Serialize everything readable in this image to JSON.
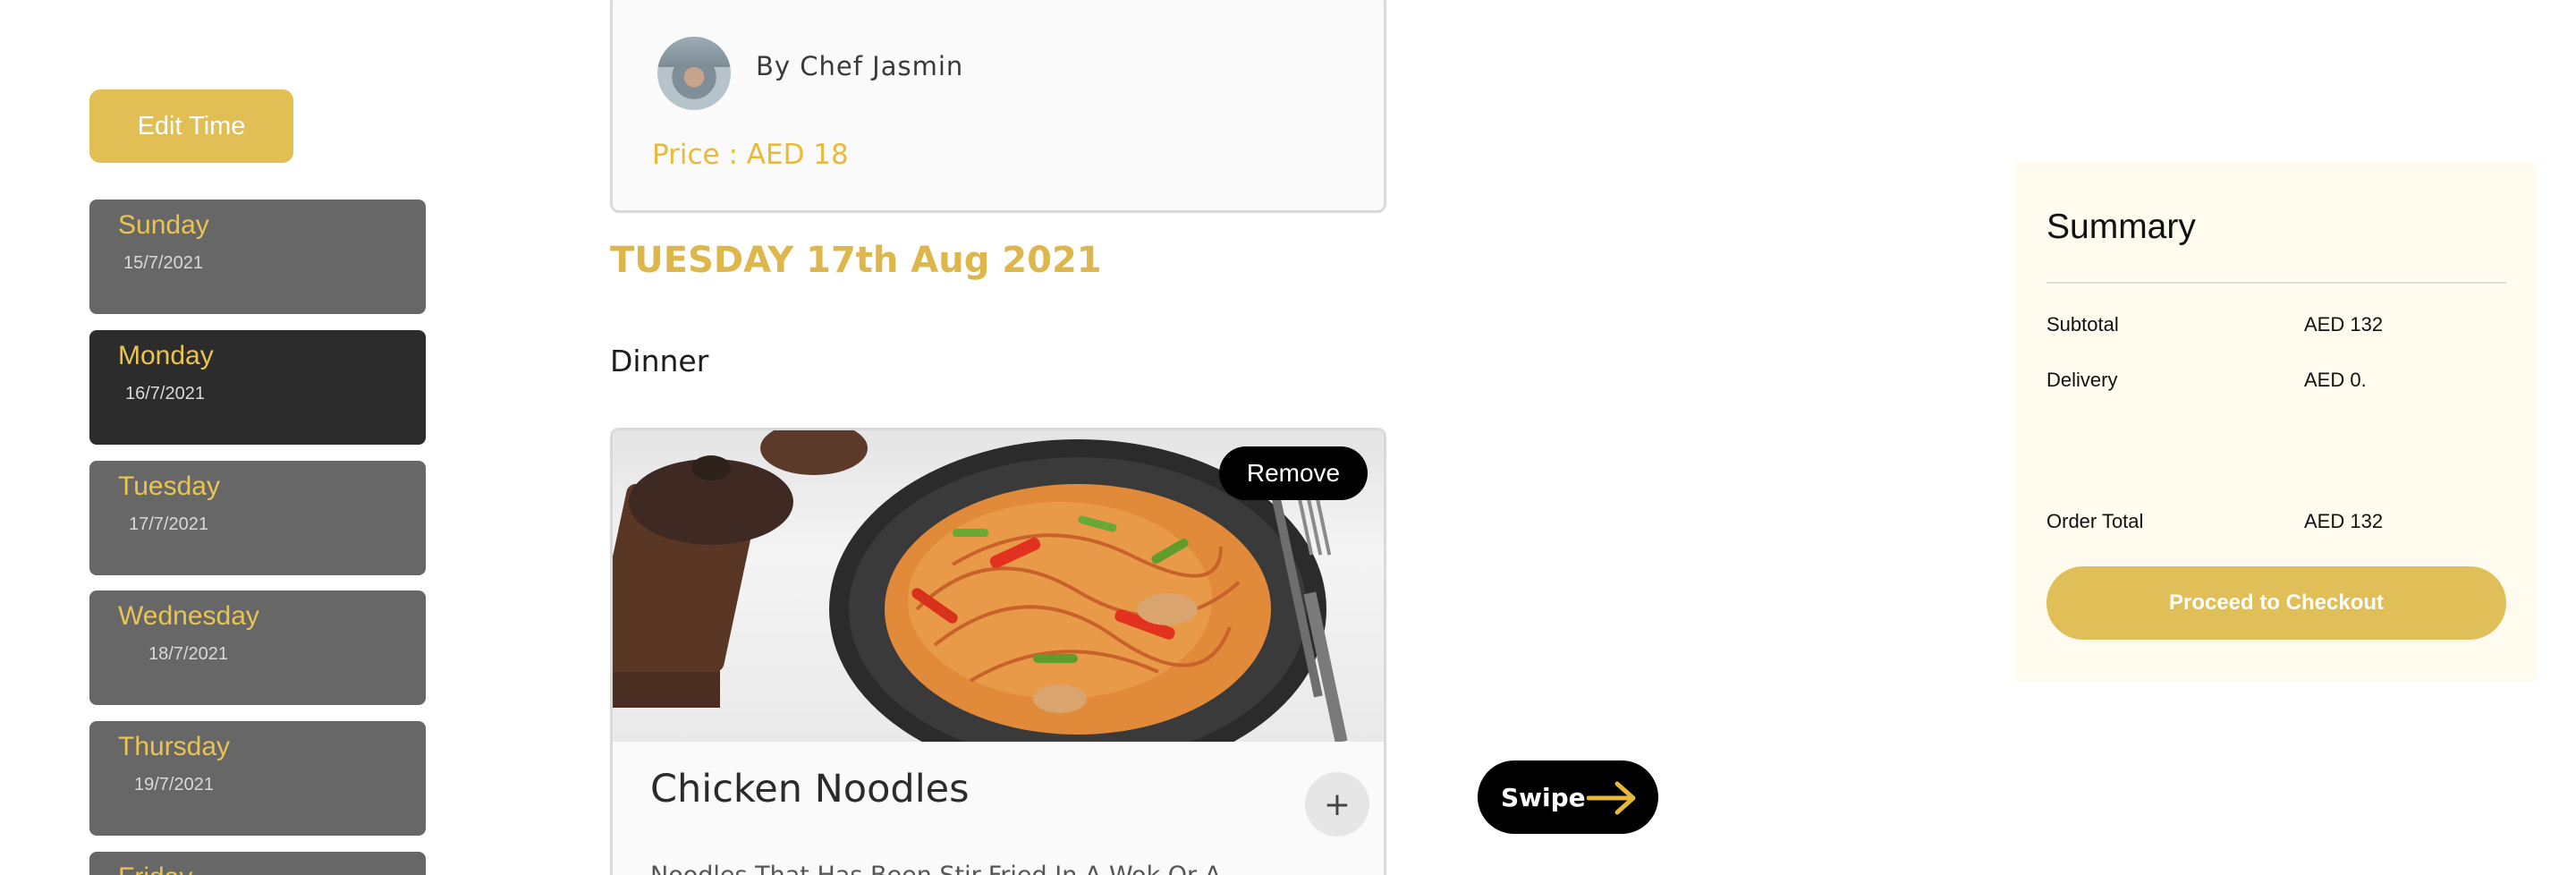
{
  "sidebar": {
    "edit_time_label": "Edit Time",
    "days": [
      {
        "name": "Sunday",
        "date": "15/7/2021",
        "active": false
      },
      {
        "name": "Monday",
        "date": "16/7/2021",
        "active": true
      },
      {
        "name": "Tuesday",
        "date": "17/7/2021",
        "active": false
      },
      {
        "name": "Wednesday",
        "date": "18/7/2021",
        "active": false
      },
      {
        "name": "Thursday",
        "date": "19/7/2021",
        "active": false
      },
      {
        "name": "Friday",
        "date": "",
        "active": false
      }
    ]
  },
  "chef_card": {
    "chef_name": "By Chef Jasmin",
    "price": "Price : AED 18"
  },
  "main": {
    "date_heading": "TUESDAY 17th Aug 2021",
    "meal_label": "Dinner"
  },
  "food_card": {
    "remove_label": "Remove",
    "title": "Chicken Noodles",
    "add_symbol": "+",
    "description": "Noodles That Has Been Stir-Fried In A Wok Or A"
  },
  "swipe": {
    "label": "Swipe",
    "icon": "arrow-right-icon"
  },
  "summary": {
    "title": "Summary",
    "subtotal_label": "Subtotal",
    "subtotal_value": "AED 132",
    "delivery_label": "Delivery",
    "delivery_value": "AED 0.",
    "order_total_label": "Order Total",
    "order_total_value": "AED 132",
    "checkout_label": "Proceed to Checkout"
  },
  "colors": {
    "accent_gold": "#e2bf55",
    "price_gold": "#e9b93a",
    "day_card": "#676767",
    "day_card_active": "#2c2c2c",
    "summary_bg": "#fffcef"
  }
}
